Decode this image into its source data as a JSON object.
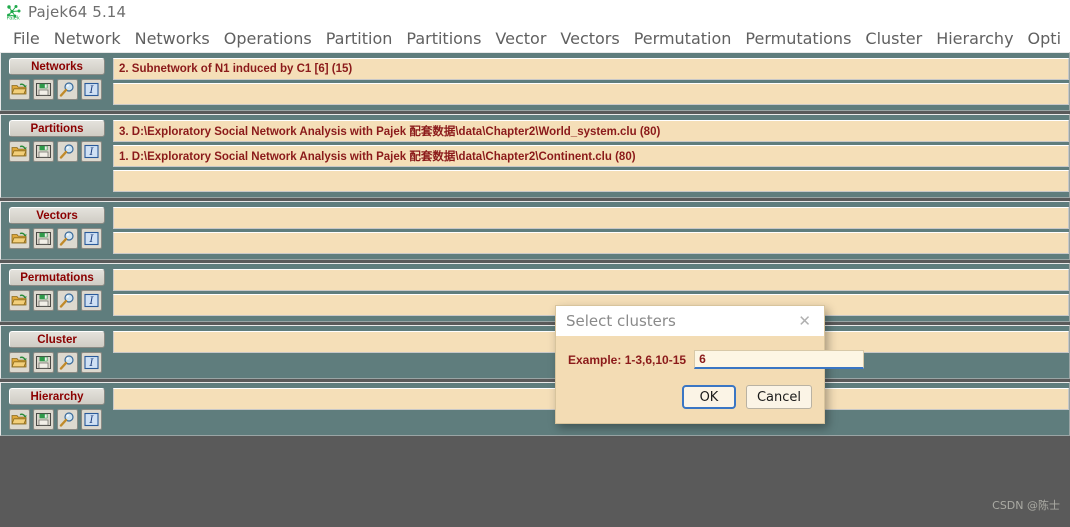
{
  "window": {
    "title": "Pajek64 5.14",
    "logo_icon": "pajek-logo-icon"
  },
  "menubar": {
    "items": [
      {
        "label": "File"
      },
      {
        "label": "Network"
      },
      {
        "label": "Networks"
      },
      {
        "label": "Operations"
      },
      {
        "label": "Partition"
      },
      {
        "label": "Partitions"
      },
      {
        "label": "Vector"
      },
      {
        "label": "Vectors"
      },
      {
        "label": "Permutation"
      },
      {
        "label": "Permutations"
      },
      {
        "label": "Cluster"
      },
      {
        "label": "Hierarchy"
      },
      {
        "label": "Opti"
      }
    ]
  },
  "toolbar_icons": [
    {
      "name": "open-file-icon",
      "title": "Open"
    },
    {
      "name": "save-file-icon",
      "title": "Save"
    },
    {
      "name": "inspect-magnifier-icon",
      "title": "Inspect"
    },
    {
      "name": "info-italic-icon",
      "title": "Info"
    }
  ],
  "panels": [
    {
      "id": "networks",
      "label": "Networks",
      "rows": [
        {
          "text": "2. Subnetwork of N1 induced by C1 [6] (15)"
        },
        {
          "text": ""
        }
      ]
    },
    {
      "id": "partitions",
      "label": "Partitions",
      "rows": [
        {
          "text": "3. D:\\Exploratory Social Network Analysis with Pajek 配套数据\\data\\Chapter2\\World_system.clu (80)"
        },
        {
          "text": "1. D:\\Exploratory Social Network Analysis with Pajek 配套数据\\data\\Chapter2\\Continent.clu (80)"
        },
        {
          "text": ""
        }
      ]
    },
    {
      "id": "vectors",
      "label": "Vectors",
      "rows": [
        {
          "text": ""
        },
        {
          "text": ""
        }
      ]
    },
    {
      "id": "permutations",
      "label": "Permutations",
      "rows": [
        {
          "text": ""
        },
        {
          "text": ""
        }
      ]
    },
    {
      "id": "cluster",
      "label": "Cluster",
      "rows": [
        {
          "text": ""
        }
      ]
    },
    {
      "id": "hierarchy",
      "label": "Hierarchy",
      "rows": [
        {
          "text": ""
        }
      ]
    }
  ],
  "dialog": {
    "title": "Select clusters",
    "close_icon": "close-icon",
    "label": "Example: 1-3,6,10-15",
    "input_value": "6",
    "input_placeholder": "",
    "ok_label": "OK",
    "cancel_label": "Cancel"
  },
  "watermark": {
    "text": "CSDN @陈士"
  },
  "colors": {
    "panel_background": "#5f7d7d",
    "list_row": "#f5dfb8",
    "accent_text": "#8B1A1A",
    "dialog_background": "#f3dcb4",
    "focus_blue": "#3a76c4"
  }
}
